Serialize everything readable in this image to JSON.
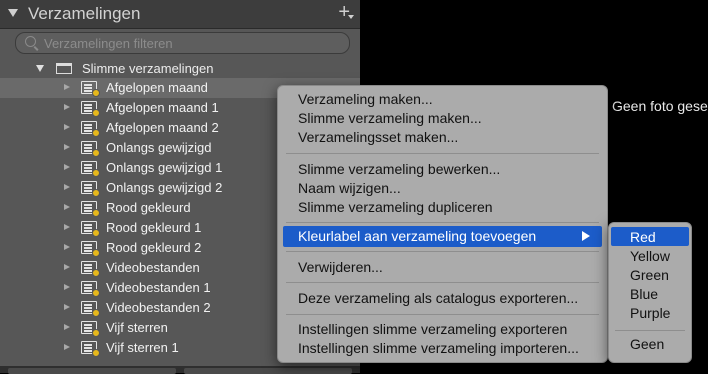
{
  "panel": {
    "title": "Verzamelingen",
    "add_symbol": "+",
    "filter_placeholder": "Verzamelingen filteren",
    "group_label": "Slimme verzamelingen",
    "collections": [
      "Afgelopen maand",
      "Afgelopen maand 1",
      "Afgelopen maand 2",
      "Onlangs gewijzigd",
      "Onlangs gewijzigd 1",
      "Onlangs gewijzigd 2",
      "Rood gekleurd",
      "Rood gekleurd 1",
      "Rood gekleurd 2",
      "Videobestanden",
      "Videobestanden 1",
      "Videobestanden 2",
      "Vijf sterren",
      "Vijf sterren 1"
    ],
    "selected_index": 0
  },
  "main": {
    "no_photo_text": "Geen foto gese"
  },
  "context_menu": {
    "items": [
      "Verzameling maken...",
      "Slimme verzameling maken...",
      "Verzamelingsset maken...",
      "Slimme verzameling bewerken...",
      "Naam wijzigen...",
      "Slimme verzameling dupliceren",
      "Kleurlabel aan verzameling toevoegen",
      "Verwijderen...",
      "Deze verzameling als catalogus exporteren...",
      "Instellingen slimme verzameling exporteren",
      "Instellingen slimme verzameling importeren..."
    ],
    "highlighted_index": 6
  },
  "color_submenu": {
    "items": [
      "Red",
      "Yellow",
      "Green",
      "Blue",
      "Purple",
      "Geen"
    ],
    "highlighted_index": 0
  },
  "colors": {
    "highlight": "#1c5cc9",
    "menu_bg": "#ababab",
    "panel_bg": "#575757"
  }
}
